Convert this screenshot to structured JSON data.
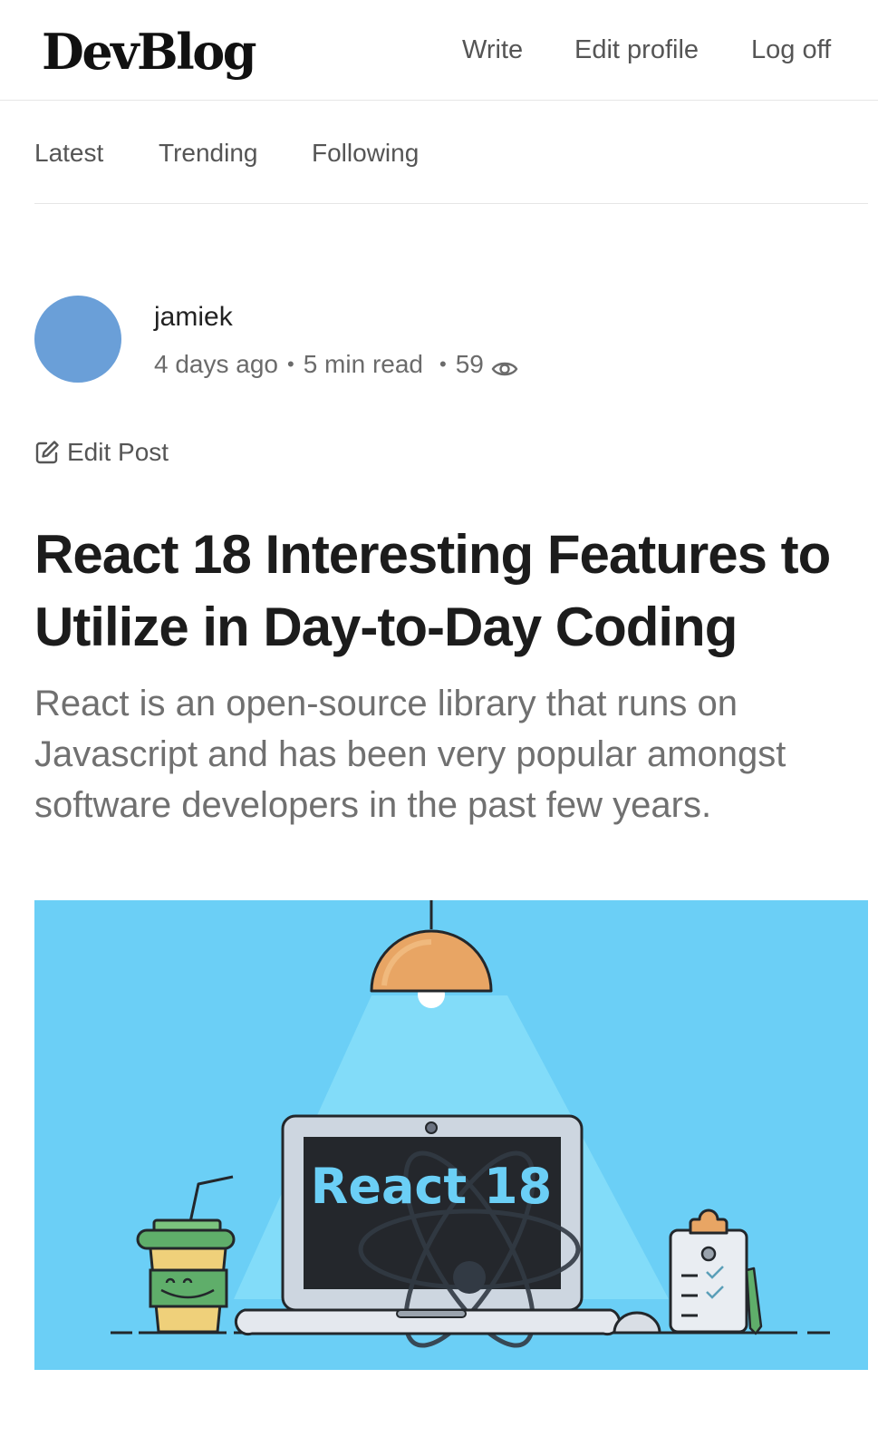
{
  "header": {
    "logo": "DevBlog",
    "nav": {
      "write": "Write",
      "edit_profile": "Edit profile",
      "log_off": "Log off"
    }
  },
  "tabs": [
    "Latest",
    "Trending",
    "Following"
  ],
  "post": {
    "author": "jamiek",
    "posted": "4 days ago",
    "read_time": "5 min read",
    "views": "59",
    "edit_label": "Edit Post",
    "title": "React 18 Interesting Features to Utilize in Day-to-Day Coding",
    "subtitle": "React is an open-source library that runs on Javascript and has been very popular amongst software developers in the past few years.",
    "hero_text": "React 18"
  },
  "colors": {
    "avatar": "#6a9fd8",
    "hero_background": "#6bcff6",
    "lamp": "#e8a564",
    "screen": "#24272c",
    "screen_text": "#6bcff6"
  },
  "icons": [
    "eye-icon",
    "edit-icon"
  ]
}
